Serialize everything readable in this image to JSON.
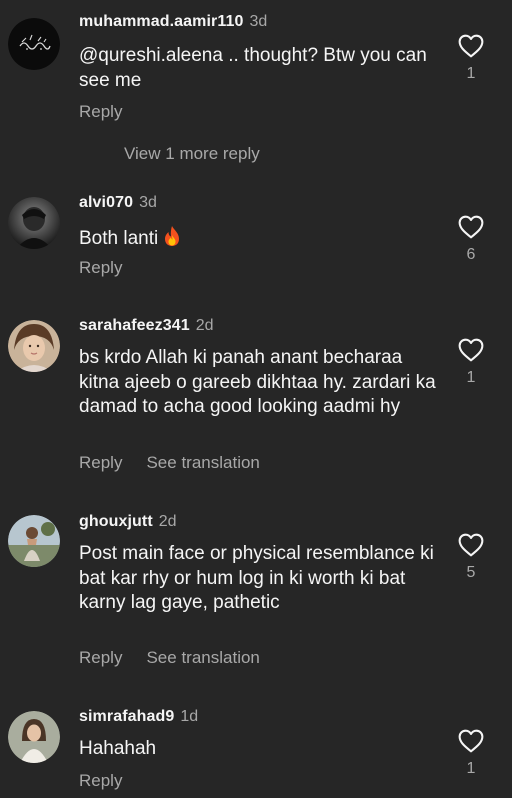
{
  "comments": [
    {
      "username": "muhammad.aamir110",
      "age": "3d",
      "text": "@qureshi.aleena .. thought? Btw you can see me",
      "reply_label": "Reply",
      "like_count": "1",
      "view_more": "View 1 more reply"
    },
    {
      "username": "alvi070",
      "age": "3d",
      "text": "Both lanti",
      "emoji": "fire",
      "reply_label": "Reply",
      "like_count": "6"
    },
    {
      "username": "sarahafeez341",
      "age": "2d",
      "text": "bs krdo Allah ki panah anant becharaa kitna ajeeb o gareeb dikhtaa hy. zardari ka damad to acha good looking aadmi hy",
      "reply_label": "Reply",
      "translate_label": "See translation",
      "like_count": "1"
    },
    {
      "username": "ghouxjutt",
      "age": "2d",
      "text": "Post main face or physical resemblance ki bat kar rhy or hum log in ki worth ki bat karny lag gaye, pathetic",
      "reply_label": "Reply",
      "translate_label": "See translation",
      "like_count": "5"
    },
    {
      "username": "simrafahad9",
      "age": "1d",
      "text": "Hahahah",
      "reply_label": "Reply",
      "like_count": "1"
    }
  ],
  "colors": {
    "background": "#262626",
    "primary_text": "#f5f5f5",
    "secondary_text": "#a8a8a8"
  },
  "icons": [
    "heart-icon",
    "fire-emoji-icon"
  ]
}
